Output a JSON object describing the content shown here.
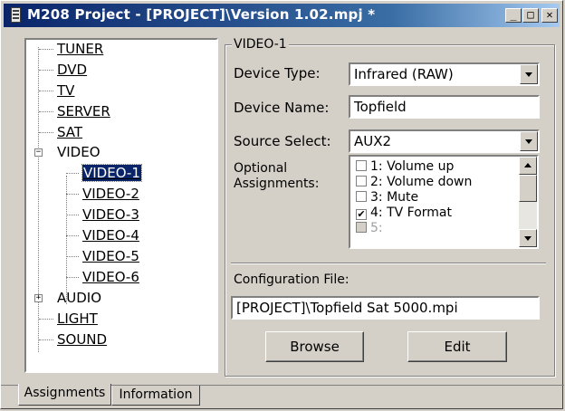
{
  "window": {
    "title": "M208 Project - [PROJECT]\\Version 1.02.mpj *",
    "controls": {
      "minimize": "_",
      "maximize": "□",
      "close": "✕"
    }
  },
  "tree": {
    "items": [
      {
        "label": "TUNER",
        "level": 0,
        "link": true
      },
      {
        "label": "DVD",
        "level": 0,
        "link": true
      },
      {
        "label": "TV",
        "level": 0,
        "link": true
      },
      {
        "label": "SERVER",
        "level": 0,
        "link": true
      },
      {
        "label": "SAT",
        "level": 0,
        "link": true
      },
      {
        "label": "VIDEO",
        "level": 0,
        "link": false,
        "expander": "−"
      },
      {
        "label": "VIDEO-1",
        "level": 1,
        "link": true,
        "selected": true
      },
      {
        "label": "VIDEO-2",
        "level": 1,
        "link": true
      },
      {
        "label": "VIDEO-3",
        "level": 1,
        "link": true
      },
      {
        "label": "VIDEO-4",
        "level": 1,
        "link": true
      },
      {
        "label": "VIDEO-5",
        "level": 1,
        "link": true
      },
      {
        "label": "VIDEO-6",
        "level": 1,
        "link": true
      },
      {
        "label": "AUDIO",
        "level": 0,
        "link": false,
        "expander": "+"
      },
      {
        "label": "LIGHT",
        "level": 0,
        "link": true
      },
      {
        "label": "SOUND",
        "level": 0,
        "link": true
      }
    ]
  },
  "panel": {
    "group_title": "VIDEO-1",
    "device_type_label": "Device Type:",
    "device_type_value": "Infrared (RAW)",
    "device_name_label": "Device Name:",
    "device_name_value": "Topfield",
    "source_select_label": "Source Select:",
    "source_select_value": "AUX2",
    "optional_label_line1": "Optional",
    "optional_label_line2": "Assignments:",
    "assignments": [
      {
        "label": "1: Volume up",
        "checked": false,
        "enabled": true
      },
      {
        "label": "2: Volume down",
        "checked": false,
        "enabled": true
      },
      {
        "label": "3: Mute",
        "checked": false,
        "enabled": true
      },
      {
        "label": "4: TV Format",
        "checked": true,
        "enabled": true
      },
      {
        "label": "5:",
        "checked": false,
        "enabled": false
      }
    ],
    "config_file_label": "Configuration File:",
    "config_file_value": "[PROJECT]\\Topfield Sat 5000.mpi",
    "browse_label": "Browse",
    "edit_label": "Edit"
  },
  "tabs": [
    {
      "label": "Assignments",
      "active": true
    },
    {
      "label": "Information",
      "active": false
    }
  ],
  "colors": {
    "selection": "#0a246a",
    "face": "#d4d0c8",
    "title_gradient_start": "#0a246a"
  }
}
